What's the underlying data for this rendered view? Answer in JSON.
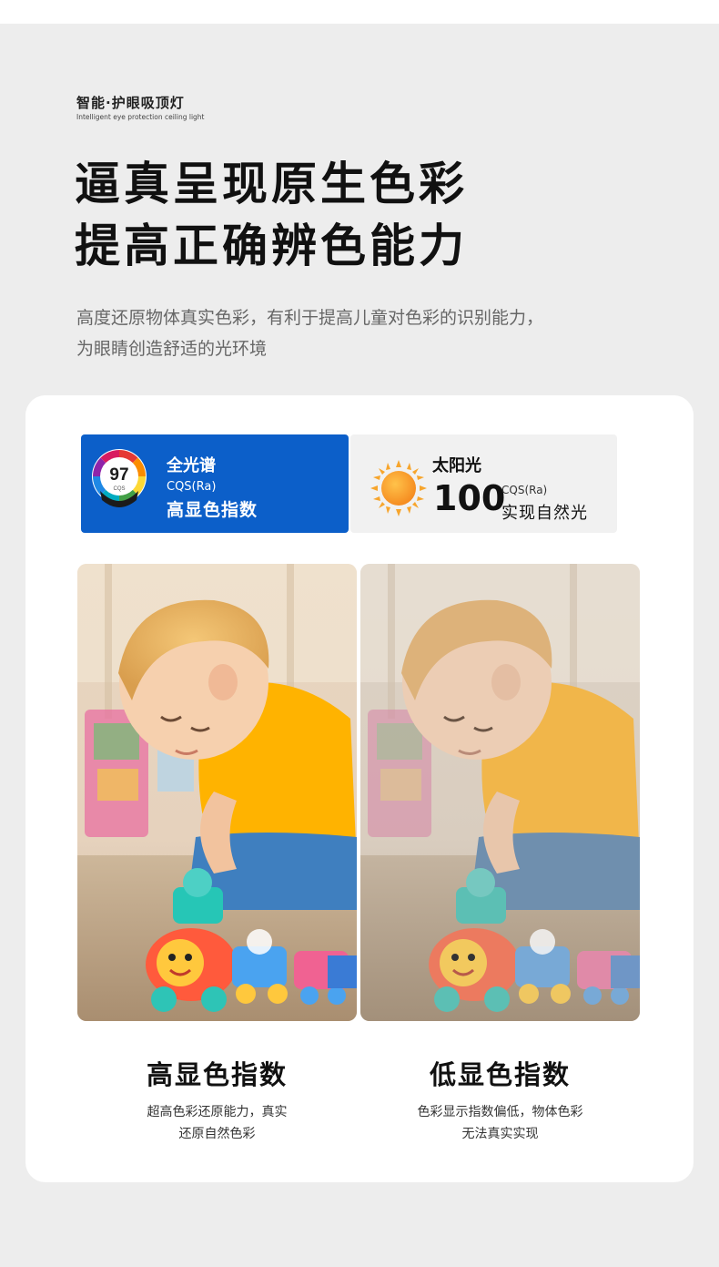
{
  "header": {
    "brand": "智能·护眼吸顶灯",
    "brand_en": "Intelligent eye protection ceiling light",
    "headline_line1": "逼真呈现原生色彩",
    "headline_line2": "提高正确辨色能力",
    "desc_line1": "高度还原物体真实色彩，有利于提高儿童对色彩的识别能力，",
    "desc_line2": "为眼睛创造舒适的光环境"
  },
  "spec_left": {
    "badge_value": "97",
    "badge_label": "CQS",
    "title": "全光谱",
    "sub": "CQS(Ra)",
    "main": "高显色指数",
    "bg_color": "#0c5fc9"
  },
  "spec_right": {
    "icon": "sun-icon",
    "title": "太阳光",
    "value": "100",
    "sub": "CQS(Ra)",
    "main": "实现自然光",
    "bg_color": "#f1f1f1"
  },
  "compare": {
    "left": {
      "title": "高显色指数",
      "line1": "超高色彩还原能力，真实",
      "line2": "还原自然色彩"
    },
    "right": {
      "title": "低显色指数",
      "line1": "色彩显示指数偏低，物体色彩",
      "line2": "无法真实实现"
    }
  }
}
